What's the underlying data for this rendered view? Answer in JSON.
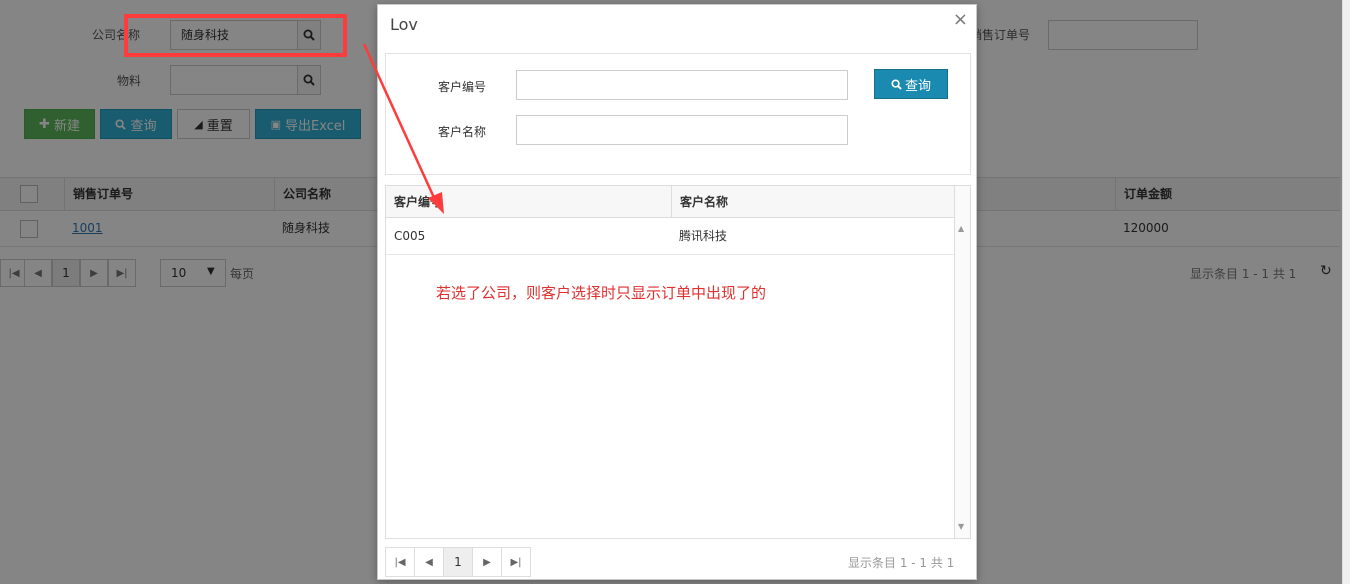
{
  "filters": {
    "company_label": "公司名称",
    "company_value": "随身科技",
    "material_label": "物料",
    "order_no_label": "销售订单号"
  },
  "toolbar": {
    "new_label": "新建",
    "query_label": "查询",
    "reset_label": "重置",
    "export_label": "导出Excel"
  },
  "grid": {
    "columns": [
      "销售订单号",
      "公司名称",
      "订单金额"
    ],
    "rows": [
      {
        "order_no": "1001",
        "company": "随身科技",
        "amount": "120000"
      }
    ],
    "page": "1",
    "page_size": "10",
    "per_page_label": "每页",
    "summary": "显示条目 1 - 1 共 1"
  },
  "modal": {
    "title": "Lov",
    "close": "×",
    "customer_code_label": "客户编号",
    "customer_name_label": "客户名称",
    "query_label": "查询",
    "columns": [
      "客户编号",
      "客户名称"
    ],
    "rows": [
      {
        "code": "C005",
        "name": "腾讯科技"
      }
    ],
    "annotation": "若选了公司，则客户选择时只显示订单中出现了的",
    "page": "1",
    "summary": "显示条目 1 - 1 共 1"
  },
  "colors": {
    "highlight": "#ff3b3b",
    "annotation": "#e03030",
    "query_button": "#1b8ab1"
  }
}
